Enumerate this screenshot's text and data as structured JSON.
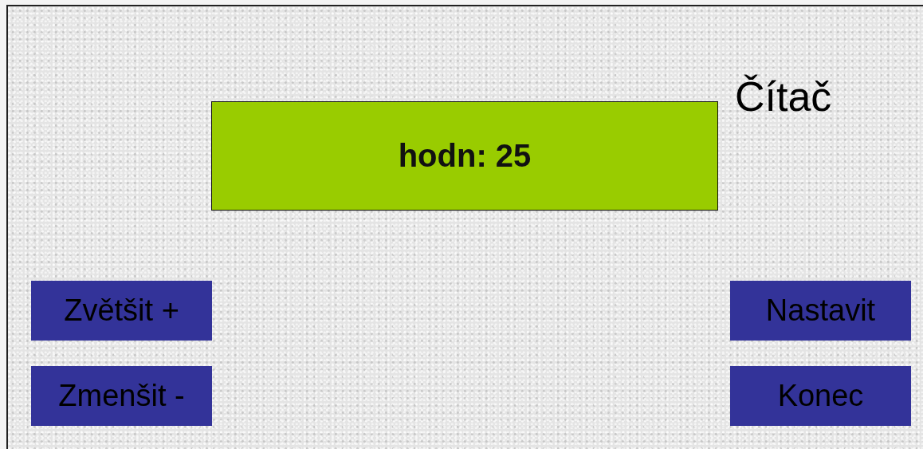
{
  "title": "Čítač",
  "display": {
    "text": "hodn: 25"
  },
  "left_buttons": [
    "Zvětšit +",
    "Zmenšit -"
  ],
  "right_buttons": [
    "Nastavit",
    "Konec"
  ]
}
